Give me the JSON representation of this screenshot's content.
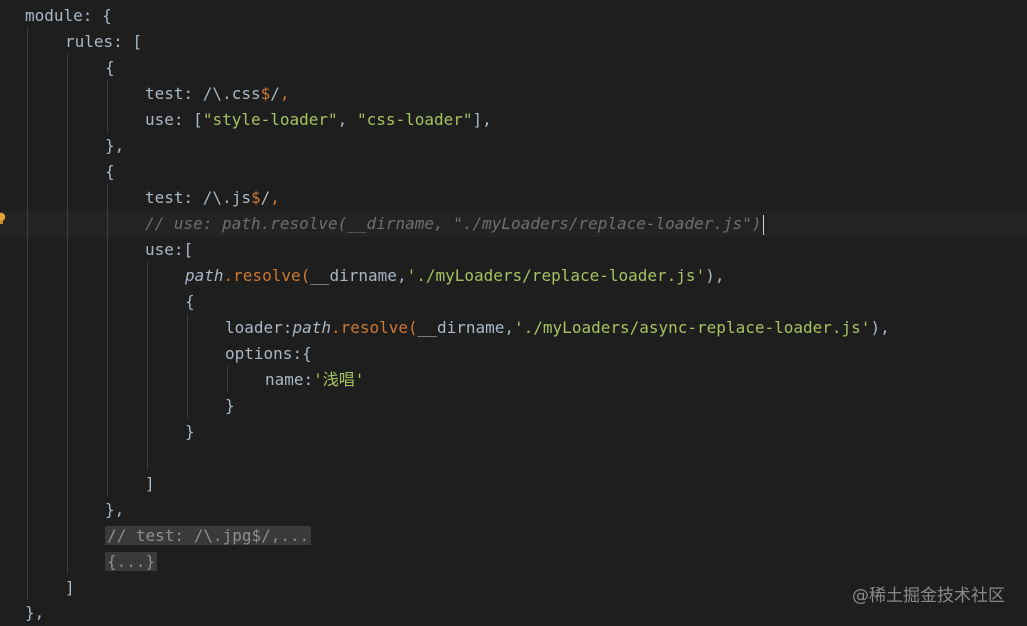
{
  "editor": {
    "l01": {
      "a": "module",
      "b": ": {"
    },
    "l02": {
      "a": "rules",
      "b": ": ["
    },
    "l03": {
      "a": "{"
    },
    "l04": {
      "a": "test",
      "b": ": ",
      "c": "/\\.css",
      "d": "$",
      "e": "/",
      "f": ","
    },
    "l05": {
      "a": "use",
      "b": ": [",
      "c": "\"style-loader\"",
      "d": ", ",
      "e": "\"css-loader\"",
      "f": "],"
    },
    "l06": {
      "a": "},"
    },
    "l07": {
      "a": "{"
    },
    "l08": {
      "a": "test",
      "b": ": ",
      "c": "/\\.js",
      "d": "$",
      "e": "/",
      "f": ","
    },
    "l09": {
      "a": "// use: path.resolve(__dirname, \"./myLoaders/replace-loader.js\")"
    },
    "l10": {
      "a": "use",
      "b": ":["
    },
    "l11": {
      "a": "path",
      "b": ".resolve(",
      "c": "__dirname",
      "d": ",",
      "e": "'./myLoaders/replace-loader.js'",
      "f": "),"
    },
    "l12": {
      "a": "{"
    },
    "l13": {
      "a": "loader",
      "b": ":",
      "c": "path",
      "d": ".resolve(",
      "e": "__dirname",
      "f": ",",
      "g": "'./myLoaders/async-replace-loader.js'",
      "h": "),"
    },
    "l14": {
      "a": "options",
      "b": ":{"
    },
    "l15": {
      "a": "name",
      "b": ":",
      "c": "'浅唱'"
    },
    "l16": {
      "a": "}"
    },
    "l17": {
      "a": "}"
    },
    "l19": {
      "a": "]"
    },
    "l20": {
      "a": "},"
    },
    "l21": {
      "a": "// test: /\\.jpg$/,..."
    },
    "l22": {
      "a": "{...}"
    },
    "l23": {
      "a": "]"
    },
    "l24": {
      "a": "},"
    }
  },
  "watermark": "@稀土掘金技术社区",
  "icons": {
    "bulb": "lightbulb-icon"
  }
}
